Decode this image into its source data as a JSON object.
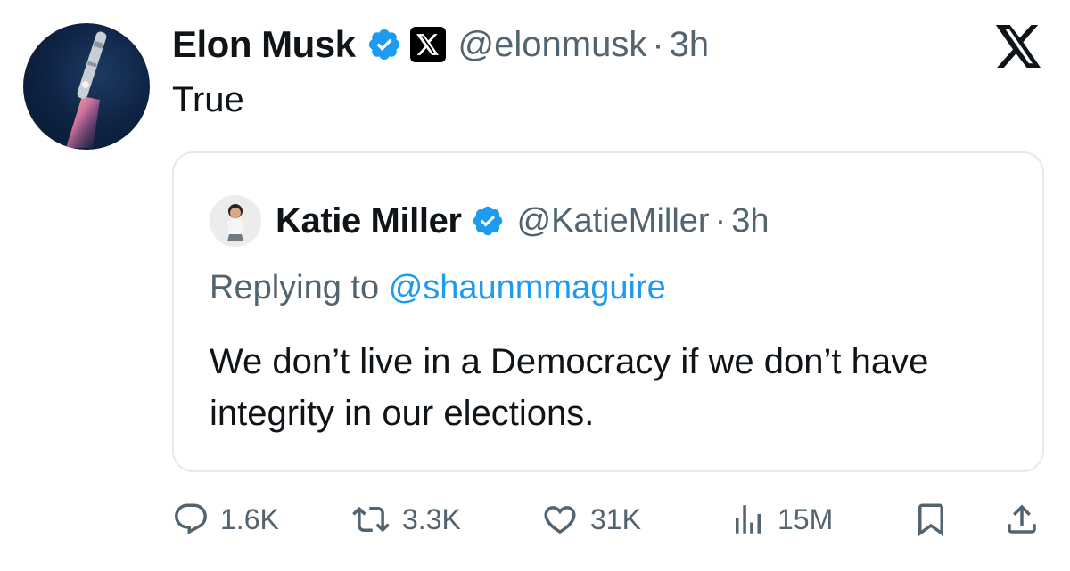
{
  "author": {
    "name": "Elon Musk",
    "handle": "@elonmusk",
    "separator": "·",
    "time": "3h",
    "avatar_icon": "rocket-launch-avatar",
    "verified_icon": "verified-badge-icon",
    "affiliate_icon": "x-logo-badge-icon"
  },
  "tweet": {
    "text": "True"
  },
  "quoted": {
    "name": "Katie Miller",
    "handle": "@KatieMiller",
    "separator": "·",
    "time": "3h",
    "replying_prefix": "Replying to",
    "replying_to": "@shaunmmaguire",
    "text": "We don’t live in a Democracy if we don’t have integrity in our elections."
  },
  "actions": {
    "replies": "1.6K",
    "reposts": "3.3K",
    "likes": "31K",
    "views": "15M"
  },
  "colors": {
    "accent": "#1d9bf0",
    "muted": "#536471",
    "text": "#0f1419",
    "border": "#e6e9ec"
  }
}
